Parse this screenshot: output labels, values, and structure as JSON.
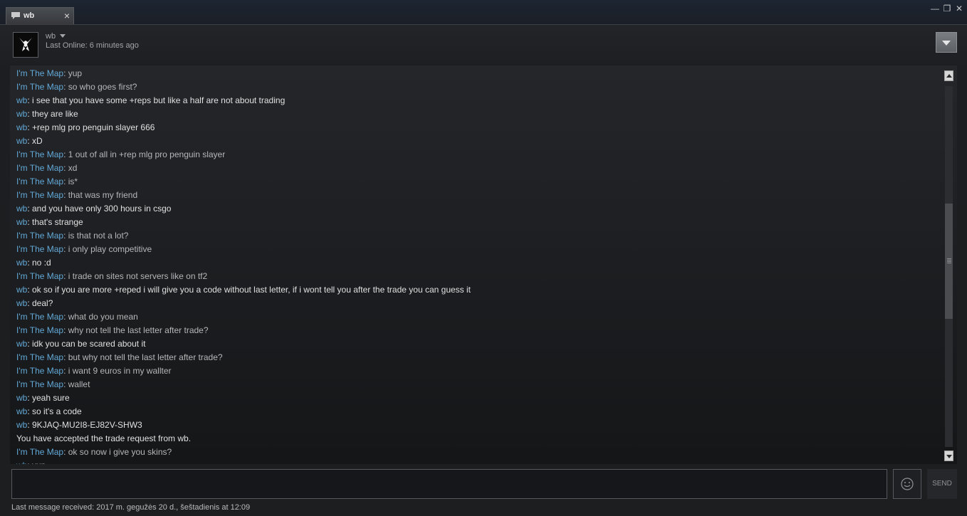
{
  "tab": {
    "title": "wb",
    "close_glyph": "×",
    "icon": "chat-bubble-icon"
  },
  "window_controls": {
    "minimize": "—",
    "restore": "❐",
    "close": "✕"
  },
  "friend": {
    "name": "wb",
    "status": "Last Online: 6 minutes ago",
    "avatar_icon": "wolf-logo-icon"
  },
  "colors": {
    "sender": "#62a8d6",
    "text": "#e0e0e0",
    "my_text": "#b4b6b8"
  },
  "messages": [
    {
      "sender": "I'm The Map",
      "text": ": yup"
    },
    {
      "sender": "I'm The Map",
      "text": ": so who goes first?"
    },
    {
      "sender": "wb",
      "text": ": i see that you have some +reps but like a half are not about trading"
    },
    {
      "sender": "wb",
      "text": ": they are like"
    },
    {
      "sender": "wb",
      "text": ": +rep mlg pro penguin slayer 666"
    },
    {
      "sender": "wb",
      "text": ": xD"
    },
    {
      "sender": "I'm The Map",
      "text": ": 1 out of all in +rep mlg pro penguin slayer"
    },
    {
      "sender": "I'm The Map",
      "text": ": xd"
    },
    {
      "sender": "I'm The Map",
      "text": ": is*"
    },
    {
      "sender": "I'm The Map",
      "text": ": that was my friend"
    },
    {
      "sender": "wb",
      "text": ": and you have only 300 hours in csgo"
    },
    {
      "sender": "wb",
      "text": ": that's strange"
    },
    {
      "sender": "I'm The Map",
      "text": ": is that not a lot?"
    },
    {
      "sender": "I'm The Map",
      "text": ": i only play competitive"
    },
    {
      "sender": "wb",
      "text": ": no :d"
    },
    {
      "sender": "I'm The Map",
      "text": ": i trade on sites not servers like on tf2"
    },
    {
      "sender": "wb",
      "text": ": ok so if you are more +reped i will give you a code without last letter, if i wont tell you after the trade you can guess it"
    },
    {
      "sender": "wb",
      "text": ": deal?"
    },
    {
      "sender": "I'm The Map",
      "text": ": what do you mean"
    },
    {
      "sender": "I'm The Map",
      "text": ": why not tell the last letter after trade?"
    },
    {
      "sender": "wb",
      "text": ": idk you can be scared about it"
    },
    {
      "sender": "I'm The Map",
      "text": ": but why not tell the last letter after trade?"
    },
    {
      "sender": "I'm The Map",
      "text": ": i want 9 euros in my wallter"
    },
    {
      "sender": "I'm The Map",
      "text": ": wallet"
    },
    {
      "sender": "wb",
      "text": ": yeah sure"
    },
    {
      "sender": "wb",
      "text": ": so it's a code"
    },
    {
      "sender": "wb",
      "text": ": 9KJAQ-MU2I8-EJ82V-SHW3"
    },
    {
      "sender": "",
      "text": "You have accepted the trade request from wb."
    },
    {
      "sender": "I'm The Map",
      "text": ": ok so now i give you skins?"
    },
    {
      "sender": "wb",
      "text": ": yup"
    }
  ],
  "input": {
    "value": "",
    "placeholder": ""
  },
  "emoticon_icon": "smiley-icon",
  "send_label": "SEND",
  "status_text": "Last message received: 2017 m. gegužės 20 d., šeštadienis at 12:09"
}
